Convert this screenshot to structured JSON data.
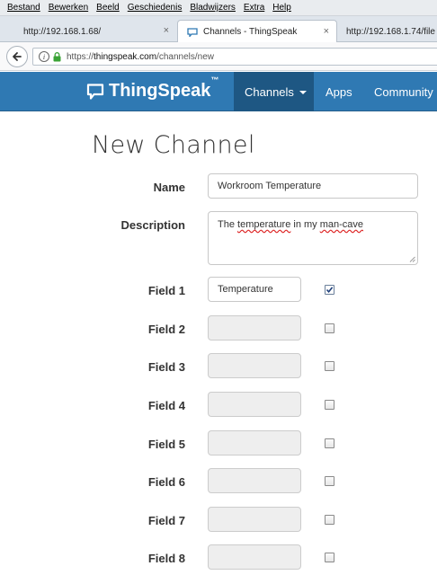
{
  "browser": {
    "menu": [
      "Bestand",
      "Bewerken",
      "Beeld",
      "Geschiedenis",
      "Bladwijzers",
      "Extra",
      "Help"
    ],
    "tabs": [
      {
        "title": "http://192.168.1.68/",
        "active": false,
        "close": "×"
      },
      {
        "title": "Channels - ThingSpeak",
        "active": true,
        "close": "×"
      },
      {
        "title": "http://192.168.1.74/file",
        "active": false
      }
    ],
    "url_prefix": "https://",
    "url_domain": "thingspeak.com",
    "url_path": "/channels/new",
    "info_glyph": "i"
  },
  "site": {
    "brand": "ThingSpeak",
    "brand_tm": "™",
    "nav": [
      {
        "label": "Channels",
        "active": true,
        "has_caret": true
      },
      {
        "label": "Apps",
        "active": false
      },
      {
        "label": "Community",
        "active": false
      }
    ],
    "brand_color": "#2f79b3",
    "nav_active_color": "#1e5783"
  },
  "form": {
    "title": "New Channel",
    "name_label": "Name",
    "name_value": "Workroom Temperature",
    "description_label": "Description",
    "description_parts": [
      "The ",
      "temperature",
      " in my ",
      "man-cave"
    ],
    "fields": [
      {
        "label": "Field 1",
        "value": "Temperature",
        "checked": true
      },
      {
        "label": "Field 2",
        "value": "",
        "checked": false
      },
      {
        "label": "Field 3",
        "value": "",
        "checked": false
      },
      {
        "label": "Field 4",
        "value": "",
        "checked": false
      },
      {
        "label": "Field 5",
        "value": "",
        "checked": false
      },
      {
        "label": "Field 6",
        "value": "",
        "checked": false
      },
      {
        "label": "Field 7",
        "value": "",
        "checked": false
      },
      {
        "label": "Field 8",
        "value": "",
        "checked": false
      }
    ]
  }
}
